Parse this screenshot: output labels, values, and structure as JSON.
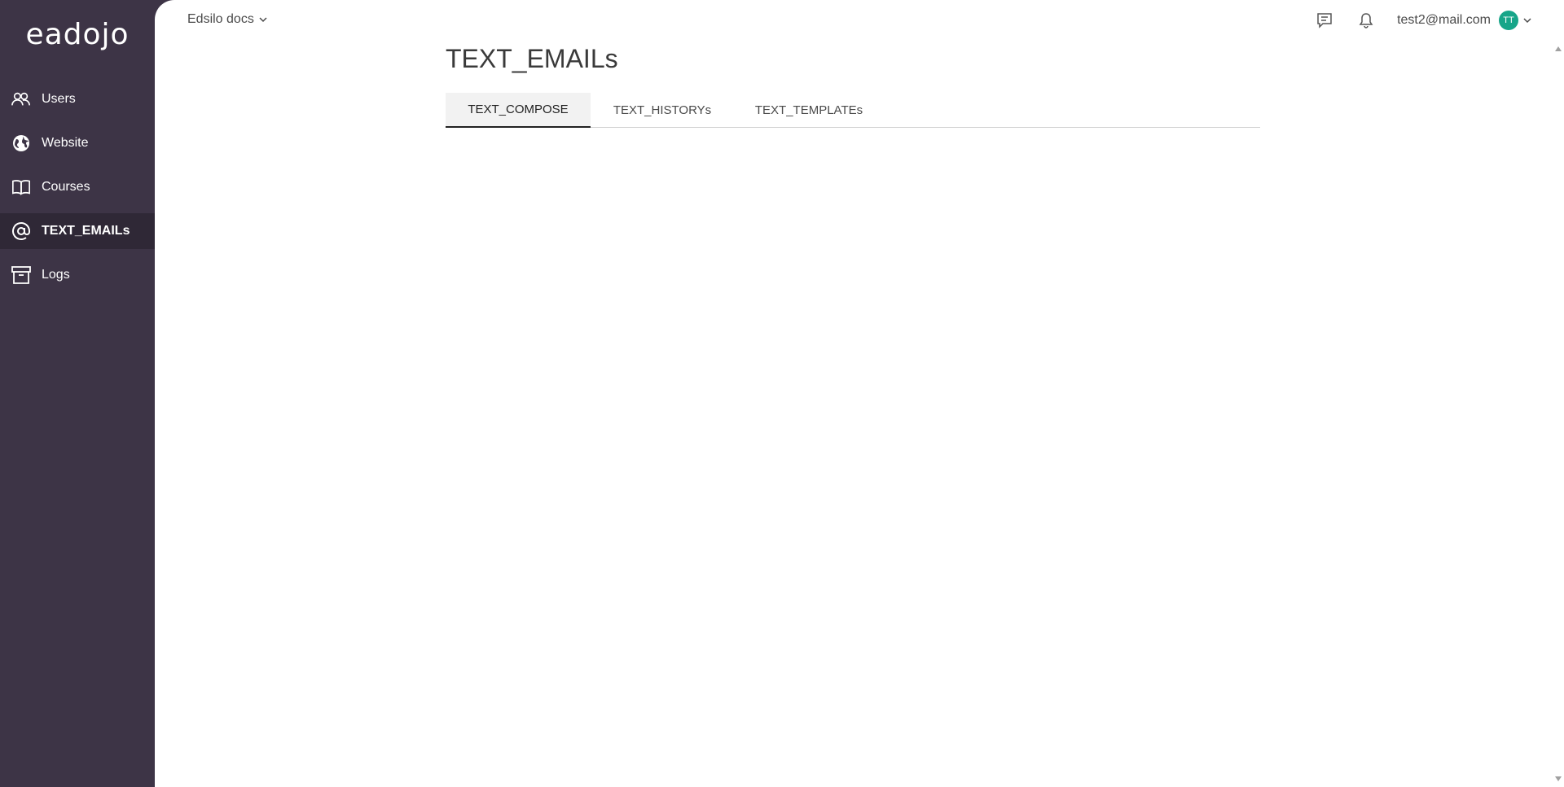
{
  "brand": {
    "logo_text": "eadojo"
  },
  "sidebar": {
    "items": [
      {
        "label": "Users",
        "icon": "users-icon",
        "active": false
      },
      {
        "label": "Website",
        "icon": "globe-icon",
        "active": false
      },
      {
        "label": "Courses",
        "icon": "book-icon",
        "active": false
      },
      {
        "label": "TEXT_EMAILs",
        "icon": "at-icon",
        "active": true
      },
      {
        "label": "Logs",
        "icon": "archive-icon",
        "active": false
      }
    ]
  },
  "topbar": {
    "org_switcher": "Edsilo docs",
    "user_email": "test2@mail.com",
    "avatar_initials": "TT",
    "icons": [
      "message-icon",
      "bell-icon",
      "chevron-down-icon"
    ]
  },
  "main": {
    "title": "TEXT_EMAILs",
    "tabs": [
      {
        "label": "TEXT_COMPOSE",
        "active": true
      },
      {
        "label": "TEXT_HISTORYs",
        "active": false
      },
      {
        "label": "TEXT_TEMPLATEs",
        "active": false
      }
    ]
  },
  "colors": {
    "sidebar_bg": "#3d3446",
    "sidebar_active_bg": "#2f2836",
    "avatar_bg": "#17a589",
    "main_bg": "#ffffff"
  }
}
